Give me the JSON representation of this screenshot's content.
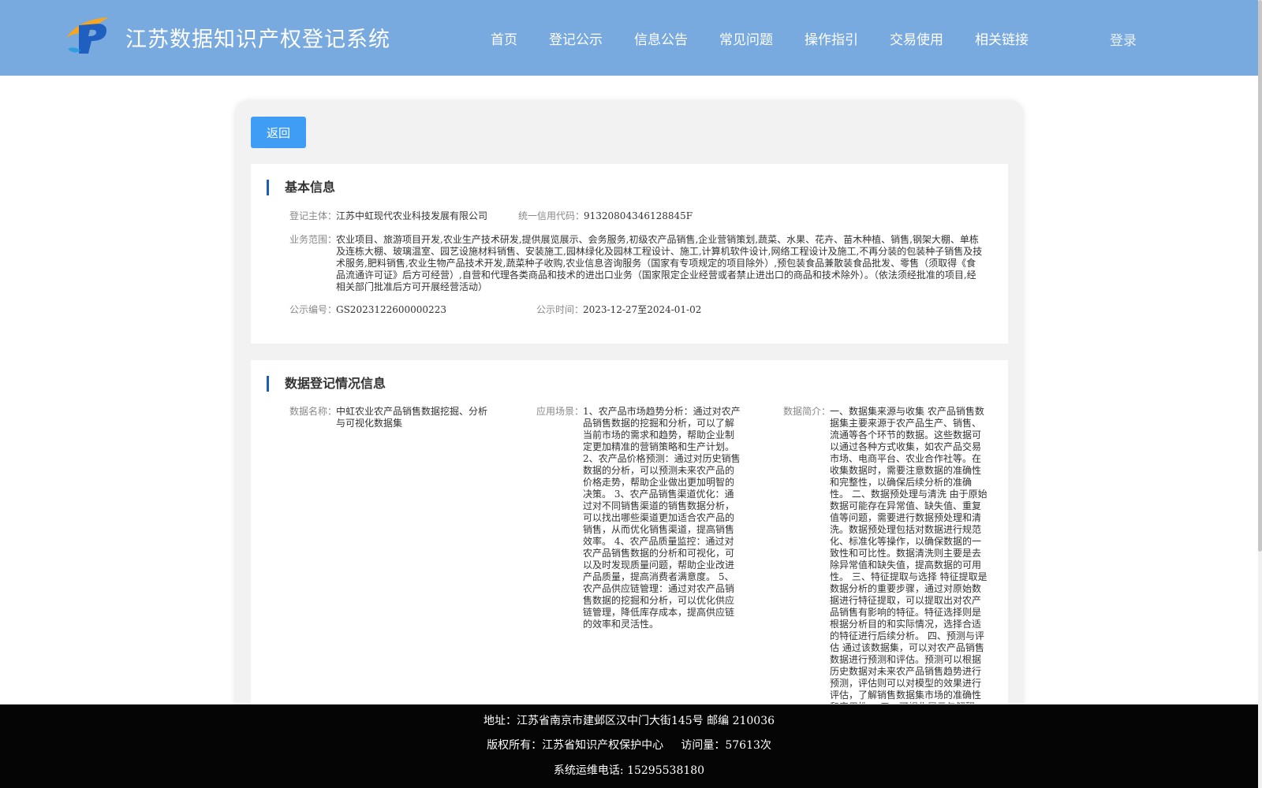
{
  "header": {
    "title": "江苏数据知识产权登记系统",
    "nav": [
      "首页",
      "登记公示",
      "信息公告",
      "常见问题",
      "操作指引",
      "交易使用",
      "相关链接"
    ],
    "login": "登录"
  },
  "back_button": "返回",
  "basic_info": {
    "title": "基本信息",
    "entity_label": "登记主体：",
    "entity_value": "江苏中虹现代农业科技发展有限公司",
    "credit_label": "统一信用代码：",
    "credit_value": "91320804346128845F",
    "scope_label": "业务范围：",
    "scope_value": "农业项目、旅游项目开发,农业生产技术研发,提供展览展示、会务服务,初级农产品销售,企业营销策划,蔬菜、水果、花卉、苗木种植、销售,钢架大棚、单栋及连栋大棚、玻璃温室、园艺设施材料销售、安装施工,园林绿化及园林工程设计、施工,计算机软件设计,网络工程设计及施工,不再分装的包装种子销售及技术服务,肥料销售,农业生物产品技术开发,蔬菜种子收购,农业信息咨询服务（国家有专项规定的项目除外）,预包装食品兼散装食品批发、零售（须取得《食品流通许可证》后方可经营）,自营和代理各类商品和技术的进出口业务（国家限定企业经营或者禁止进出口的商品和技术除外）。（依法须经批准的项目,经相关部门批准后方可开展经营活动）",
    "pubno_label": "公示编号：",
    "pubno_value": "GS2023122600000223",
    "pubtime_label": "公示时间：",
    "pubtime_value": "2023-12-27至2024-01-02"
  },
  "data_info": {
    "title": "数据登记情况信息",
    "name_label": "数据名称：",
    "name_value": "中虹农业农产品销售数据挖掘、分析与可视化数据集",
    "scene_label": "应用场景：",
    "scene_value": "1、农产品市场趋势分析：通过对农产品销售数据的挖掘和分析，可以了解当前市场的需求和趋势，帮助企业制定更加精准的营销策略和生产计划。 2、农产品价格预测：通过对历史销售数据的分析，可以预测未来农产品的价格走势，帮助企业做出更加明智的决策。 3、农产品销售渠道优化：通过对不同销售渠道的销售数据分析，可以找出哪些渠道更加适合农产品的销售，从而优化销售渠道，提高销售效率。 4、农产品质量监控：通过对农产品销售数据的分析和可视化，可以及时发现质量问题，帮助企业改进产品质量，提高消费者满意度。 5、农产品供应链管理：通过对农产品销售数据的挖掘和分析，可以优化供应链管理，降低库存成本，提高供应链的效率和灵活性。",
    "intro_label": "数据简介：",
    "intro_value": "一、数据集来源与收集 农产品销售数据集主要来源于农产品生产、销售、流通等各个环节的数据。这些数据可以通过各种方式收集，如农产品交易市场、电商平台、农业合作社等。在收集数据时，需要注意数据的准确性和完整性，以确保后续分析的准确性。 二、数据预处理与清洗 由于原始数据可能存在异常值、缺失值、重复值等问题，需要进行数据预处理和清洗。数据预处理包括对数据进行规范化、标准化等操作，以确保数据的一致性和可比性。数据清洗则主要是去除异常值和缺失值，提高数据的可用性。 三、特征提取与选择 特征提取是数据分析的重要步骤，通过对原始数据进行特征提取，可以提取出对农产品销售有影响的特征。特征选择则是根据分析目的和实际情况，选择合适的特征进行后续分析。 四、预测与评估 通过该数据集，可以对农产品销售数据进行预测和评估。预测可以根据历史数据对未来农产品销售趋势进行预测，评估则可以对模型的效果进行评估，了解销售数据集市场的准确性和实用性。 五、可视化展示与解释"
  },
  "footer": {
    "address": "地址：江苏省南京市建邺区汉中门大街145号 邮编 210036",
    "copyright": "版权所有：江苏省知识产权保护中心     访问量：57613次",
    "phone": "系统运维电话: 15295538180"
  },
  "colors": {
    "header_bg": "#78aadf",
    "button_bg": "#3f9df6",
    "accent_bar": "#1a5fb4",
    "footer_bg": "#050505"
  }
}
